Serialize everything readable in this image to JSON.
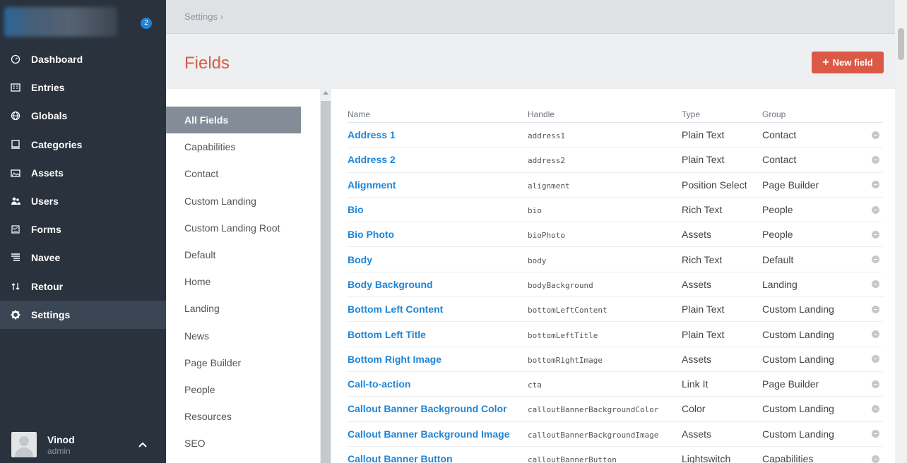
{
  "sidebar": {
    "site_name": "",
    "badge": "2",
    "items": [
      {
        "label": "Dashboard",
        "icon": "dashboard-icon"
      },
      {
        "label": "Entries",
        "icon": "entries-icon"
      },
      {
        "label": "Globals",
        "icon": "globe-icon"
      },
      {
        "label": "Categories",
        "icon": "categories-icon"
      },
      {
        "label": "Assets",
        "icon": "assets-icon"
      },
      {
        "label": "Users",
        "icon": "users-icon"
      },
      {
        "label": "Forms",
        "icon": "forms-icon"
      },
      {
        "label": "Navee",
        "icon": "navee-icon"
      },
      {
        "label": "Retour",
        "icon": "retour-icon"
      },
      {
        "label": "Settings",
        "icon": "gear-icon",
        "active": true
      }
    ],
    "user": {
      "name": "Vinod",
      "role": "admin"
    }
  },
  "breadcrumb": {
    "text": "Settings ›"
  },
  "page": {
    "title": "Fields",
    "new_button": "New field"
  },
  "groups": {
    "active": "All Fields",
    "items": [
      "All Fields",
      "Capabilities",
      "Contact",
      "Custom Landing",
      "Custom Landing Root",
      "Default",
      "Home",
      "Landing",
      "News",
      "Page Builder",
      "People",
      "Resources",
      "SEO"
    ]
  },
  "table": {
    "headers": {
      "name": "Name",
      "handle": "Handle",
      "type": "Type",
      "group": "Group"
    },
    "rows": [
      {
        "name": "Address 1",
        "handle": "address1",
        "type": "Plain Text",
        "group": "Contact"
      },
      {
        "name": "Address 2",
        "handle": "address2",
        "type": "Plain Text",
        "group": "Contact"
      },
      {
        "name": "Alignment",
        "handle": "alignment",
        "type": "Position Select",
        "group": "Page Builder"
      },
      {
        "name": "Bio",
        "handle": "bio",
        "type": "Rich Text",
        "group": "People"
      },
      {
        "name": "Bio Photo",
        "handle": "bioPhoto",
        "type": "Assets",
        "group": "People"
      },
      {
        "name": "Body",
        "handle": "body",
        "type": "Rich Text",
        "group": "Default"
      },
      {
        "name": "Body Background",
        "handle": "bodyBackground",
        "type": "Assets",
        "group": "Landing"
      },
      {
        "name": "Bottom Left Content",
        "handle": "bottomLeftContent",
        "type": "Plain Text",
        "group": "Custom Landing"
      },
      {
        "name": "Bottom Left Title",
        "handle": "bottomLeftTitle",
        "type": "Plain Text",
        "group": "Custom Landing"
      },
      {
        "name": "Bottom Right Image",
        "handle": "bottomRightImage",
        "type": "Assets",
        "group": "Custom Landing"
      },
      {
        "name": "Call-to-action",
        "handle": "cta",
        "type": "Link It",
        "group": "Page Builder"
      },
      {
        "name": "Callout Banner Background Color",
        "handle": "calloutBannerBackgroundColor",
        "type": "Color",
        "group": "Custom Landing"
      },
      {
        "name": "Callout Banner Background Image",
        "handle": "calloutBannerBackgroundImage",
        "type": "Assets",
        "group": "Custom Landing"
      },
      {
        "name": "Callout Banner Button",
        "handle": "calloutBannerButton",
        "type": "Lightswitch",
        "group": "Capabilities"
      }
    ]
  },
  "colors": {
    "accent": "#da5a47",
    "link": "#1f85d6",
    "sidebar": "#29323d"
  }
}
